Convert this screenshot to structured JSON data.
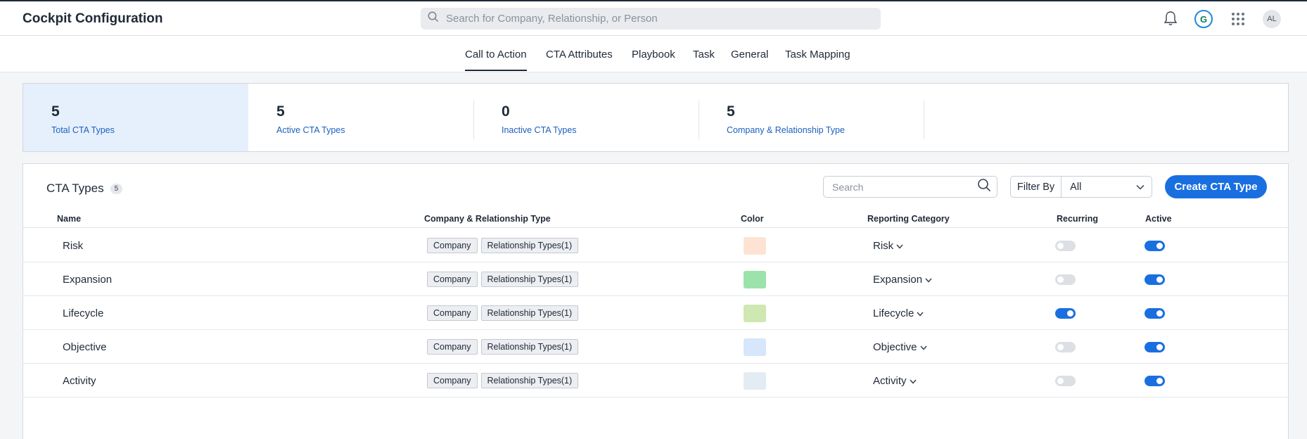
{
  "app": {
    "title": "Cockpit Configuration",
    "search_placeholder": "Search for Company, Relationship, or Person",
    "avatar_initials": "AL",
    "logo_letter": "G"
  },
  "tabs": [
    {
      "label": "Call to Action",
      "active": true
    },
    {
      "label": "CTA Attributes",
      "active": false
    },
    {
      "label": "Playbook",
      "active": false
    },
    {
      "label": "Task",
      "active": false
    },
    {
      "label": "General",
      "active": false
    },
    {
      "label": "Task Mapping",
      "active": false
    }
  ],
  "summary": [
    {
      "value": "5",
      "label": "Total CTA Types",
      "selected": true
    },
    {
      "value": "5",
      "label": "Active CTA Types",
      "selected": false
    },
    {
      "value": "0",
      "label": "Inactive CTA Types",
      "selected": false
    },
    {
      "value": "5",
      "label": "Company & Relationship Type",
      "selected": false
    }
  ],
  "panel": {
    "title": "CTA Types",
    "count": "5",
    "search_placeholder": "Search",
    "filter_label": "Filter By",
    "filter_value": "All",
    "create_label": "Create CTA Type"
  },
  "table": {
    "headers": {
      "name": "Name",
      "type": "Company & Relationship Type",
      "color": "Color",
      "category": "Reporting Category",
      "recurring": "Recurring",
      "active": "Active"
    },
    "rows": [
      {
        "name": "Risk",
        "company": "Company",
        "rel": "Relationship Types(1)",
        "color": "#fde3d3",
        "category": "Risk",
        "recurring": false,
        "active": true
      },
      {
        "name": "Expansion",
        "company": "Company",
        "rel": "Relationship Types(1)",
        "color": "#9be3aa",
        "category": "Expansion",
        "recurring": false,
        "active": true
      },
      {
        "name": "Lifecycle",
        "company": "Company",
        "rel": "Relationship Types(1)",
        "color": "#cfe7b1",
        "category": "Lifecycle",
        "recurring": true,
        "active": true
      },
      {
        "name": "Objective",
        "company": "Company",
        "rel": "Relationship Types(1)",
        "color": "#d6e6fb",
        "category": "Objective",
        "recurring": false,
        "active": true
      },
      {
        "name": "Activity",
        "company": "Company",
        "rel": "Relationship Types(1)",
        "color": "#e3ebf3",
        "category": "Activity",
        "recurring": false,
        "active": true
      }
    ]
  },
  "colors": {
    "accent": "#1a6fe0",
    "link": "#1d5fbf",
    "selected_bg": "#e6f0fc"
  }
}
